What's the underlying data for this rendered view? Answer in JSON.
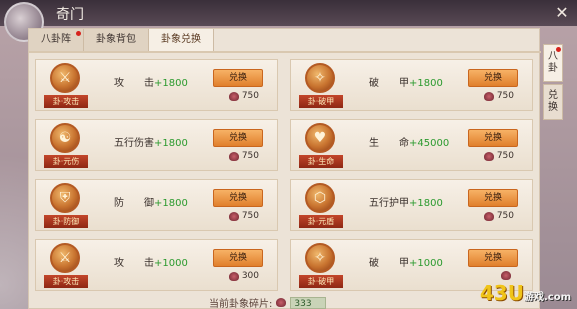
{
  "window": {
    "title": "奇门",
    "close_label": "✕"
  },
  "tabs": [
    {
      "label": "八卦阵",
      "active": false,
      "has_dot": true
    },
    {
      "label": "卦象背包",
      "active": false,
      "has_dot": false
    },
    {
      "label": "卦象兑换",
      "active": true,
      "has_dot": false
    }
  ],
  "side_tabs": [
    {
      "label": "八卦",
      "active": true
    },
    {
      "label": "兑换",
      "active": false
    }
  ],
  "cards": [
    {
      "tag": "卦·攻击",
      "attr": "攻　　击",
      "bonus": "+1800",
      "button": "兑换",
      "cost": "750"
    },
    {
      "tag": "卦·破甲",
      "attr": "破　　甲",
      "bonus": "+1800",
      "button": "兑换",
      "cost": "750"
    },
    {
      "tag": "卦·元伤",
      "attr": "五行伤害",
      "bonus": "+1800",
      "button": "兑换",
      "cost": "750"
    },
    {
      "tag": "卦·生命",
      "attr": "生　　命",
      "bonus": "+45000",
      "button": "兑换",
      "cost": "750"
    },
    {
      "tag": "卦·防御",
      "attr": "防　　御",
      "bonus": "+1800",
      "button": "兑换",
      "cost": "750"
    },
    {
      "tag": "卦·元盾",
      "attr": "五行护甲",
      "bonus": "+1800",
      "button": "兑换",
      "cost": "750"
    },
    {
      "tag": "卦·攻击",
      "attr": "攻　　击",
      "bonus": "+1000",
      "button": "兑换",
      "cost": "300"
    },
    {
      "tag": "卦·破甲",
      "attr": "破　　甲",
      "bonus": "+1000",
      "button": "兑换",
      "cost": ""
    }
  ],
  "footer": {
    "label": "当前卦象碎片:",
    "count": "333"
  },
  "watermark": {
    "main": "43U",
    "sub": "游戏",
    "domain": ".com"
  },
  "colors": {
    "accent": "#e07f2c",
    "bonus": "#2b9a2e",
    "tag": "#8e2713"
  }
}
